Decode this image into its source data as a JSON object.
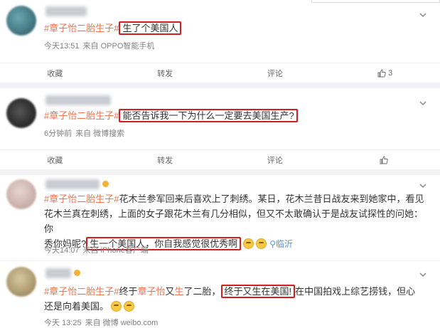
{
  "posts": [
    {
      "hashtag": "#章子怡二胎生子#",
      "body_plain": "",
      "body_box": "生了个美国人",
      "body_rest": "",
      "time": "今天13:51",
      "source": "来自 OPPO智能手机"
    },
    {
      "hashtag": "#章子怡二胎生子#",
      "body_box": "能否告诉我一下为什么一定要去美国生产?",
      "time": "6分钟前",
      "source": "来自 微博搜索"
    },
    {
      "hashtag": "#章子怡二胎生子#",
      "line1": "花木兰参军回来后喜欢上了刺绣。某日，花木兰昔日战友来到她家中，看见",
      "line2": "花木兰真在刺绣，上面的女子跟花木兰有几分相似，但又不太敢确认于是战友试探性的问她：你",
      "line3_start": "秀你妈呢?",
      "body_box": "生一个美国人，你自我感觉很优秀啊",
      "location": "临沂",
      "time": "今天14:07",
      "source": "来自 iPhone客户端"
    },
    {
      "hashtag": "#章子怡二胎生子#",
      "line1_a": "终于",
      "line1_hl1": "章子怡",
      "line1_b": "又",
      "line1_hl2": "生",
      "line1_c": "了二胎，",
      "body_box": "终于又生在美国!",
      "line1_d": "在中国拍戏上综艺捞钱，但心",
      "line2": "还是向着美国。",
      "time": "今天 13:25",
      "source": "来自 微博 weibo.com"
    }
  ],
  "actions_bar_1": {
    "favorite": "收藏",
    "repost": "转发",
    "comment": "评论",
    "like": "3"
  },
  "actions_bar_2": {
    "favorite": "收藏",
    "repost": "转发",
    "comment": "评论",
    "like": ""
  },
  "colors": {
    "hashtag": "#eb7350",
    "box": "#d21e1e",
    "meta": "#808080"
  }
}
